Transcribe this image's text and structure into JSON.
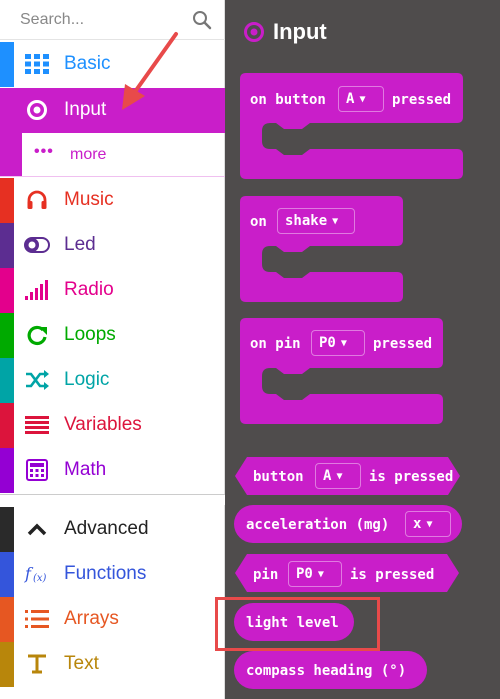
{
  "search": {
    "placeholder": "Search..."
  },
  "categories": [
    {
      "label": "Basic",
      "color": "#1e90ff",
      "icon": "grid-icon"
    },
    {
      "label": "Input",
      "color": "#c91ec9",
      "icon": "target-icon",
      "active": true
    },
    {
      "label": "Music",
      "color": "#e63022",
      "icon": "headphones-icon"
    },
    {
      "label": "Led",
      "color": "#5c2d91",
      "icon": "toggle-icon"
    },
    {
      "label": "Radio",
      "color": "#e3008c",
      "icon": "signal-bars-icon"
    },
    {
      "label": "Loops",
      "color": "#00aa00",
      "icon": "refresh-icon"
    },
    {
      "label": "Logic",
      "color": "#00a4a6",
      "icon": "shuffle-icon"
    },
    {
      "label": "Variables",
      "color": "#dc143c",
      "icon": "lines-icon"
    },
    {
      "label": "Math",
      "color": "#9400d3",
      "icon": "calculator-icon"
    },
    {
      "label": "Advanced",
      "color": "#3c3c3c",
      "icon": "chevron-up-icon"
    },
    {
      "label": "Functions",
      "color": "#3455db",
      "icon": "function-icon"
    },
    {
      "label": "Arrays",
      "color": "#e65722",
      "icon": "list-icon"
    },
    {
      "label": "Text",
      "color": "#b8860b",
      "icon": "text-t-icon"
    }
  ],
  "more": {
    "dots": "•••",
    "label": "more"
  },
  "flyout": {
    "title": "Input",
    "blocks": {
      "on_button": {
        "prefix": "on button",
        "dropdown": "A",
        "suffix": "pressed"
      },
      "on_shake": {
        "prefix": "on",
        "dropdown": "shake"
      },
      "on_pin": {
        "prefix": "on pin",
        "dropdown": "P0",
        "suffix": "pressed"
      },
      "button_is_pressed": {
        "prefix": "button",
        "dropdown": "A",
        "suffix": "is pressed"
      },
      "acceleration": {
        "prefix": "acceleration (mg)",
        "dropdown": "x"
      },
      "pin_is_pressed": {
        "prefix": "pin",
        "dropdown": "P0",
        "suffix": "is pressed"
      },
      "light_level": {
        "label": "light level"
      },
      "compass_heading": {
        "label": "compass heading (°)"
      }
    }
  },
  "colors": {
    "accent": "#c91ec9",
    "flyout_bg": "#4f4c4c",
    "highlight": "#e84a4a",
    "arrow": "#e84a4a"
  }
}
